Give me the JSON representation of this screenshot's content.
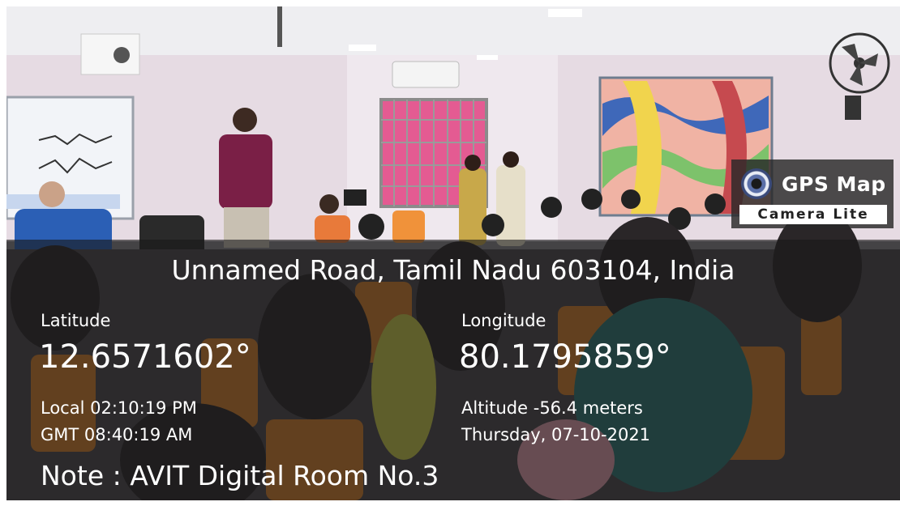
{
  "badge": {
    "title": "GPS Map",
    "subtitle": "Camera Lite",
    "icon": "map-pin-camera-icon"
  },
  "location": {
    "address": "Unnamed Road, Tamil Nadu 603104, India",
    "latitude_label": "Latitude",
    "latitude_value": "12.6571602°",
    "longitude_label": "Longitude",
    "longitude_value": "80.1795859°",
    "local_time": "Local 02:10:19 PM",
    "gmt_time": "GMT 08:40:19 AM",
    "altitude": "Altitude -56.4 meters",
    "date": "Thursday, 07-10-2021",
    "note": "Note : AVIT Digital Room No.3"
  },
  "colors": {
    "overlay": "#191919",
    "chair": "#e08a2a",
    "wall": "#e9dfe6",
    "window": "#e2578e"
  }
}
